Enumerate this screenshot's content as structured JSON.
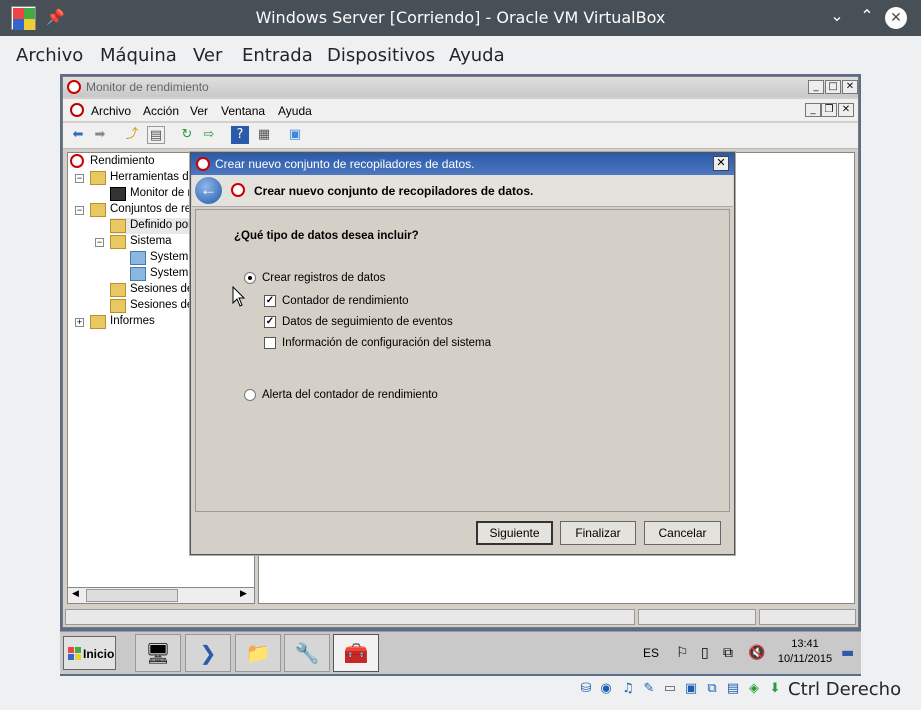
{
  "host": {
    "title": "Windows Server [Corriendo] - Oracle VM VirtualBox",
    "menu": [
      "Archivo",
      "Máquina",
      "Ver",
      "Entrada",
      "Dispositivos",
      "Ayuda"
    ],
    "host_key": "Ctrl Derecho"
  },
  "mmc": {
    "title": "Monitor de rendimiento",
    "menu": [
      "Archivo",
      "Acción",
      "Ver",
      "Ventana",
      "Ayuda"
    ],
    "tree": [
      {
        "label": "Rendimiento"
      },
      {
        "label": "Herramientas de"
      },
      {
        "label": "Monitor de re"
      },
      {
        "label": "Conjuntos de rec"
      },
      {
        "label": "Definido por"
      },
      {
        "label": "Sistema"
      },
      {
        "label": "System D"
      },
      {
        "label": "System P"
      },
      {
        "label": "Sesiones de"
      },
      {
        "label": "Sesiones de"
      },
      {
        "label": "Informes"
      }
    ]
  },
  "wizard": {
    "title": "Crear nuevo conjunto de recopiladores de datos.",
    "header": "Crear nuevo conjunto de recopiladores de datos.",
    "question": "¿Qué tipo de datos desea incluir?",
    "option_logs": "Crear registros de datos",
    "option_logs_selected": true,
    "checkboxes": [
      {
        "label": "Contador de rendimiento",
        "checked": true
      },
      {
        "label": "Datos de seguimiento de eventos",
        "checked": true
      },
      {
        "label": "Información de configuración del sistema",
        "checked": false
      }
    ],
    "option_alert": "Alerta del contador de rendimiento",
    "option_alert_selected": false,
    "buttons": {
      "next": "Siguiente",
      "finish": "Finalizar",
      "cancel": "Cancelar"
    }
  },
  "taskbar": {
    "start_label": "Inicio",
    "lang": "ES",
    "time": "13:41",
    "date": "10/11/2015"
  }
}
